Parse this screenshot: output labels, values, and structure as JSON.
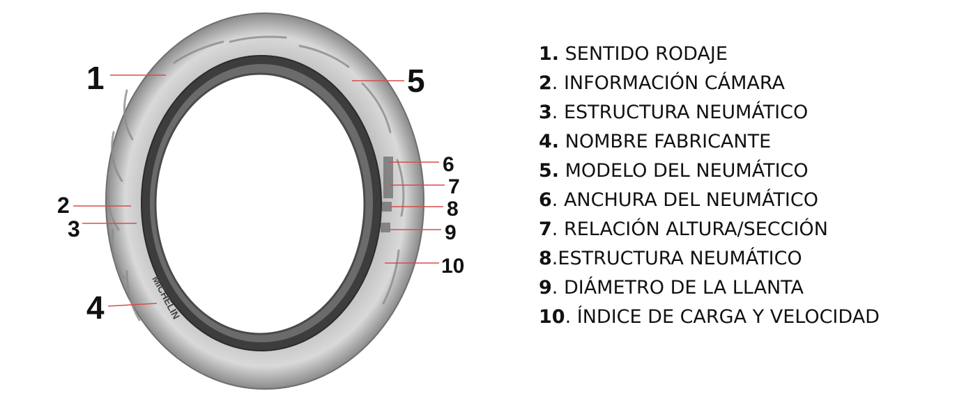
{
  "brand_marking": "MICHELIN",
  "colors": {
    "callout_line": "#d84b4b",
    "tire_dark": "#3a3a3a",
    "tire_mid": "#9a9a9a",
    "tire_light": "#d6d6d6"
  },
  "callouts": [
    {
      "num": "1"
    },
    {
      "num": "2"
    },
    {
      "num": "3"
    },
    {
      "num": "4"
    },
    {
      "num": "5"
    },
    {
      "num": "6"
    },
    {
      "num": "7"
    },
    {
      "num": "8"
    },
    {
      "num": "9"
    },
    {
      "num": "10"
    }
  ],
  "legend": [
    {
      "num": "1.",
      "label": " SENTIDO RODAJE"
    },
    {
      "num": "2",
      "label": ". INFORMACIÓN CÁMARA"
    },
    {
      "num": "3",
      "label": ". ESTRUCTURA NEUMÁTICO"
    },
    {
      "num": "4.",
      "label": " NOMBRE FABRICANTE"
    },
    {
      "num": "5.",
      "label": " MODELO DEL NEUMÁTICO"
    },
    {
      "num": "6",
      "label": ". ANCHURA DEL NEUMÁTICO"
    },
    {
      "num": "7",
      "label": ". RELACIÓN ALTURA/SECCIÓN"
    },
    {
      "num": "8",
      "label": ".ESTRUCTURA NEUMÁTICO"
    },
    {
      "num": "9",
      "label": ". DIÁMETRO DE LA LLANTA"
    },
    {
      "num": "10",
      "label": ". ÍNDICE DE CARGA Y VELOCIDAD"
    }
  ]
}
